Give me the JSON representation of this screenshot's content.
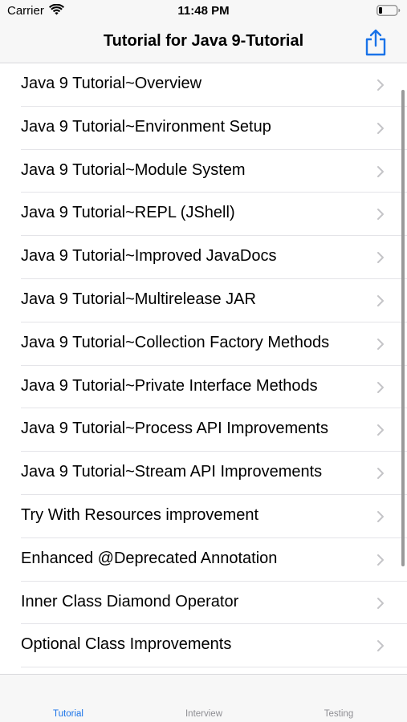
{
  "status_bar": {
    "carrier": "Carrier",
    "time": "11:48 PM"
  },
  "nav": {
    "title": "Tutorial for Java 9-Tutorial",
    "share_icon": "share-icon"
  },
  "list": {
    "items": [
      {
        "label": "Java 9 Tutorial~Overview"
      },
      {
        "label": "Java 9 Tutorial~Environment Setup"
      },
      {
        "label": "Java 9 Tutorial~Module System"
      },
      {
        "label": "Java 9 Tutorial~REPL (JShell)"
      },
      {
        "label": "Java 9 Tutorial~Improved JavaDocs"
      },
      {
        "label": "Java 9 Tutorial~Multirelease JAR"
      },
      {
        "label": "Java 9 Tutorial~Collection Factory Methods"
      },
      {
        "label": "Java 9 Tutorial~Private Interface Methods"
      },
      {
        "label": "Java 9 Tutorial~Process API Improvements"
      },
      {
        "label": "Java 9 Tutorial~Stream API Improvements"
      },
      {
        "label": "Try With Resources improvement"
      },
      {
        "label": "Enhanced @Deprecated Annotation"
      },
      {
        "label": "Inner Class Diamond Operator"
      },
      {
        "label": "Optional Class Improvements"
      }
    ]
  },
  "tabs": [
    {
      "label": "Tutorial",
      "selected": true
    },
    {
      "label": "Interview",
      "selected": false
    },
    {
      "label": "Testing",
      "selected": false
    }
  ],
  "colors": {
    "accent": "#1a73e8",
    "inactive_tab": "#8e8e93",
    "bar_background": "#f7f7f7"
  }
}
